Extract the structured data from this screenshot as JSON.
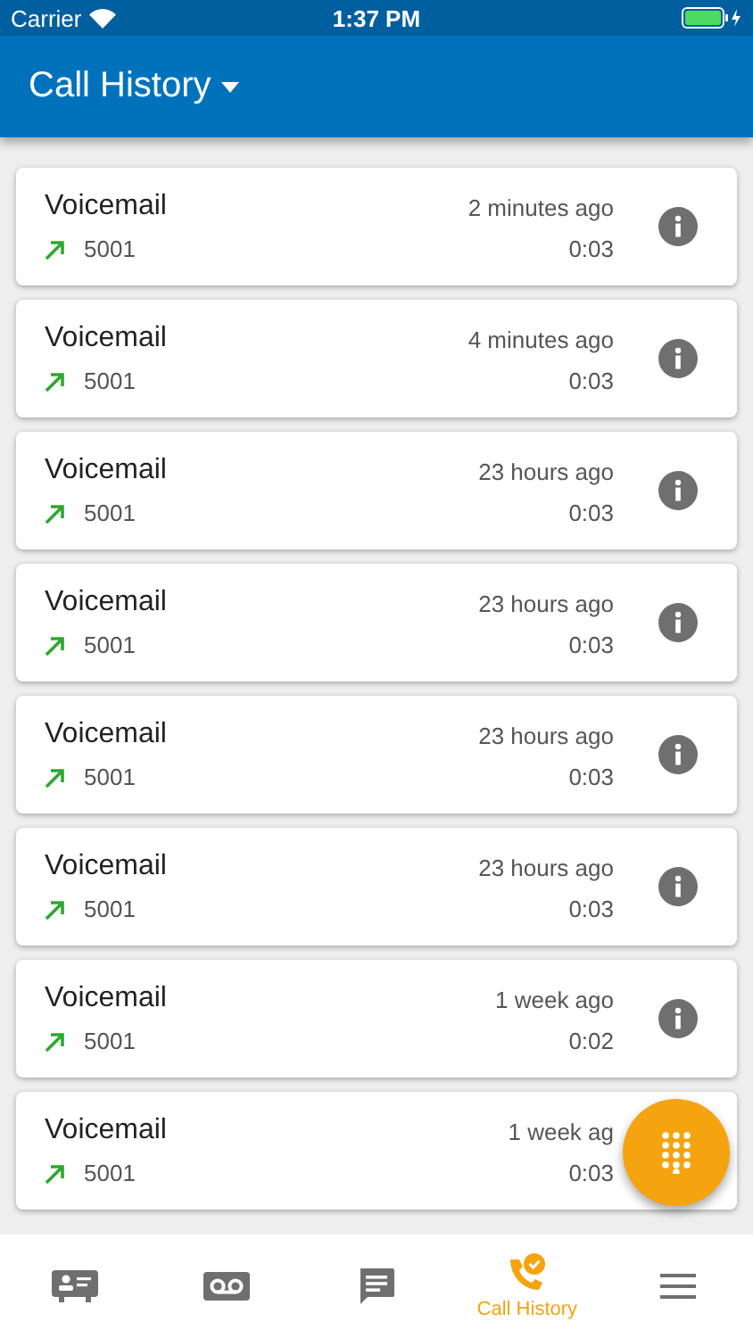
{
  "status_bar": {
    "carrier": "Carrier",
    "time": "1:37 PM"
  },
  "header": {
    "title": "Call History"
  },
  "calls": [
    {
      "name": "Voicemail",
      "time": "2 minutes ago",
      "number": "5001",
      "duration": "0:03",
      "info": true
    },
    {
      "name": "Voicemail",
      "time": "4 minutes ago",
      "number": "5001",
      "duration": "0:03",
      "info": true
    },
    {
      "name": "Voicemail",
      "time": "23 hours ago",
      "number": "5001",
      "duration": "0:03",
      "info": true
    },
    {
      "name": "Voicemail",
      "time": "23 hours ago",
      "number": "5001",
      "duration": "0:03",
      "info": true
    },
    {
      "name": "Voicemail",
      "time": "23 hours ago",
      "number": "5001",
      "duration": "0:03",
      "info": true
    },
    {
      "name": "Voicemail",
      "time": "23 hours ago",
      "number": "5001",
      "duration": "0:03",
      "info": true
    },
    {
      "name": "Voicemail",
      "time": "1 week ago",
      "number": "5001",
      "duration": "0:02",
      "info": true
    },
    {
      "name": "Voicemail",
      "time": "1 week ag",
      "number": "5001",
      "duration": "0:03",
      "info": false
    }
  ],
  "nav": [
    {
      "kind": "contacts",
      "selected": false
    },
    {
      "kind": "voicemail",
      "selected": false
    },
    {
      "kind": "messages",
      "selected": false
    },
    {
      "kind": "history",
      "selected": true,
      "label": "Call History"
    },
    {
      "kind": "menu",
      "selected": false
    }
  ]
}
